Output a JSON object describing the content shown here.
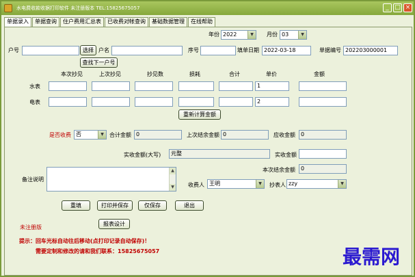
{
  "window": {
    "title": "水电费收款收据打印软件 未注册版本 TEL:15825675057",
    "minimize": "_",
    "maximize": "□",
    "close": "×"
  },
  "tabs": [
    "单据录入",
    "单据查询",
    "住户费用汇总表",
    "已收费对帐查询",
    "基础数据管理",
    "在线帮助"
  ],
  "header": {
    "year_label": "年份",
    "year_value": "2022",
    "month_label": "月份",
    "month_value": "03",
    "household_label": "户号",
    "household_value": "",
    "select_button": "选择",
    "name_label": "户名",
    "name_value": "",
    "seq_label": "序号",
    "seq_value": "",
    "date_label": "填单日期",
    "date_value": "2022-03-18",
    "doc_label": "单据编号",
    "doc_value": "202203000001",
    "find_next_button": "查找下一户号"
  },
  "meter_table": {
    "columns": [
      "本次抄见",
      "上次抄见",
      "抄见数",
      "损耗",
      "合计",
      "单价",
      "金额"
    ],
    "rows": [
      {
        "label": "水表",
        "values": [
          "",
          "",
          "",
          "",
          "",
          "1",
          ""
        ]
      },
      {
        "label": "电表",
        "values": [
          "",
          "",
          "",
          "",
          "",
          "2",
          ""
        ]
      }
    ],
    "recalc_button": "重新计算金额"
  },
  "charges": {
    "paid_label": "是否收费",
    "paid_value": "否",
    "total_label": "合计金额",
    "total_value": "0",
    "last_balance_label": "上次结余金额",
    "last_balance_value": "0",
    "due_label": "应收金额",
    "due_value": "0",
    "received_caps_label": "实收金额(大写)",
    "received_caps_value": "元整",
    "received_label": "实收金额",
    "received_value": "",
    "current_balance_label": "本次结余金额",
    "current_balance_value": "0"
  },
  "notes": {
    "label": "备注说明",
    "value": ""
  },
  "people": {
    "collector_label": "收费人",
    "collector_value": "王明",
    "reader_label": "抄表人",
    "reader_value": "zzy"
  },
  "actions": [
    "重填",
    "打印并保存",
    "仅保存",
    "退出"
  ],
  "footer": {
    "unregistered": "未注册版",
    "report_button": "报表设计",
    "tip_line1": "提示：回车光标自动往后移动(点打印记录自动保存)！",
    "tip_line2": "需要定制和修改的请和我们联系：15825675057",
    "watermark": "最需网"
  }
}
